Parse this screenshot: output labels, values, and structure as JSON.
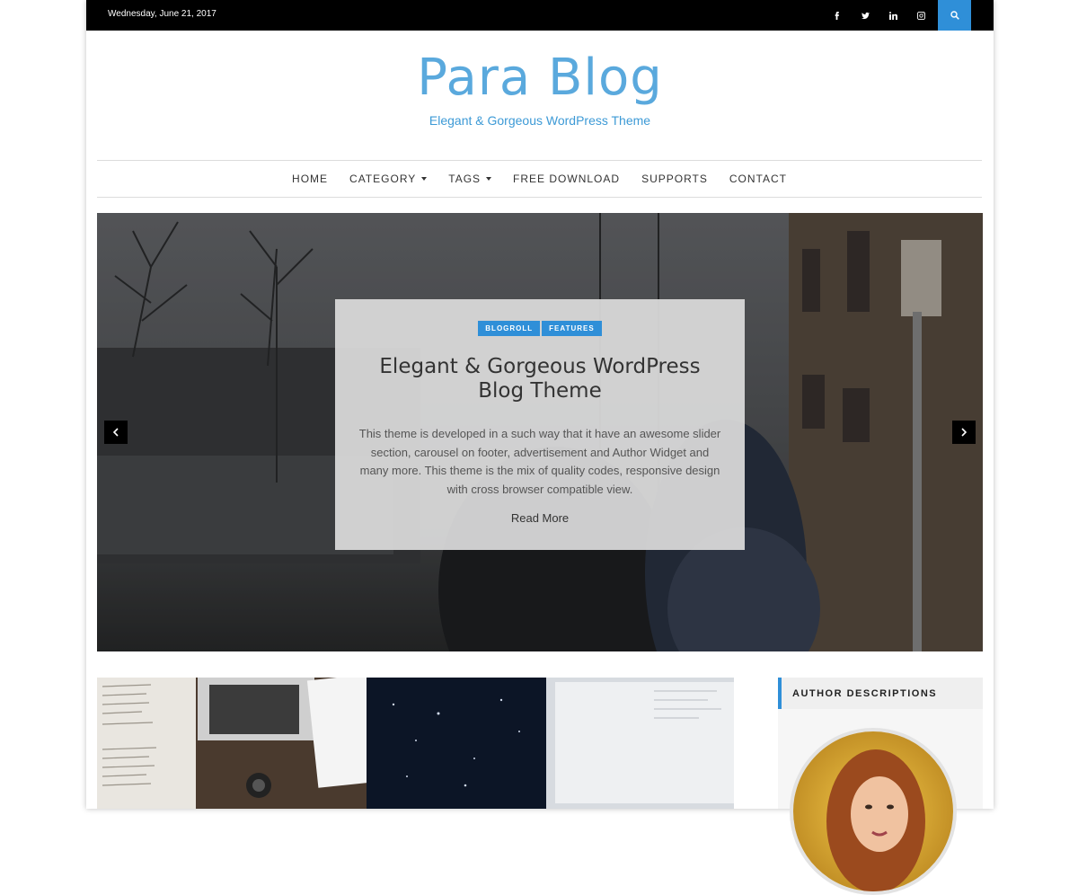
{
  "topbar": {
    "date": "Wednesday, June 21, 2017",
    "social": [
      "facebook-icon",
      "twitter-icon",
      "linkedin-icon",
      "instagram-icon"
    ],
    "search_icon": "search-icon"
  },
  "site": {
    "title": "Para Blog",
    "tagline": "Elegant & Gorgeous WordPress Theme"
  },
  "nav": {
    "items": [
      {
        "label": "HOME"
      },
      {
        "label": "CATEGORY"
      },
      {
        "label": "TAGS"
      },
      {
        "label": "FREE DOWNLOAD"
      },
      {
        "label": "SUPPORTS"
      },
      {
        "label": "CONTACT"
      }
    ]
  },
  "slider": {
    "tags": [
      "BLOGROLL",
      "FEATURES"
    ],
    "title": "Elegant & Gorgeous WordPress Blog Theme",
    "excerpt": "This theme is developed in a such way that it have an awesome slider section, carousel on footer, advertisement and Author Widget and many more. This theme is the mix of quality codes, responsive design with cross browser compatible view.",
    "read_more": "Read More"
  },
  "sidebar": {
    "heading": "AUTHOR DESCRIPTIONS"
  },
  "colors": {
    "accent": "#2f8fd8",
    "title": "#5aa9dd",
    "topbar": "#000000"
  }
}
